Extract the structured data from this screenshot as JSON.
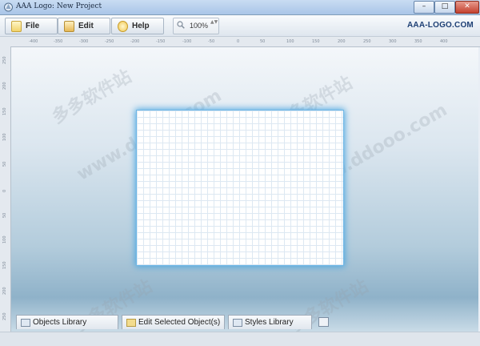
{
  "window": {
    "title": "AAA Logo: New Project",
    "controls": {
      "minimize": "–",
      "maximize": "□",
      "close": "✕"
    }
  },
  "toolbar": {
    "file_label": "File",
    "edit_label": "Edit",
    "help_label": "Help",
    "zoom_value": "100%",
    "zoom_spin": "▲▼",
    "brand": "AAA-LOGO.COM"
  },
  "ruler": {
    "horizontal": [
      "-400",
      "-350",
      "-300",
      "-250",
      "-200",
      "-150",
      "-100",
      "-50",
      "0",
      "50",
      "100",
      "150",
      "200",
      "250",
      "300",
      "350",
      "400"
    ],
    "vertical": [
      "250",
      "200",
      "150",
      "100",
      "50",
      "0",
      "50",
      "100",
      "150",
      "200",
      "250"
    ]
  },
  "watermark": {
    "text_cn": "多多软件站",
    "text_url": "www.ddooo.com"
  },
  "bottom_tabs": {
    "objects": "Objects Library",
    "edit_selected": "Edit Selected Object(s)",
    "styles": "Styles Library"
  },
  "colors": {
    "canvas_glow": "#4aa6e0",
    "brand": "#1d3f74",
    "close_button": "#c4412f"
  }
}
